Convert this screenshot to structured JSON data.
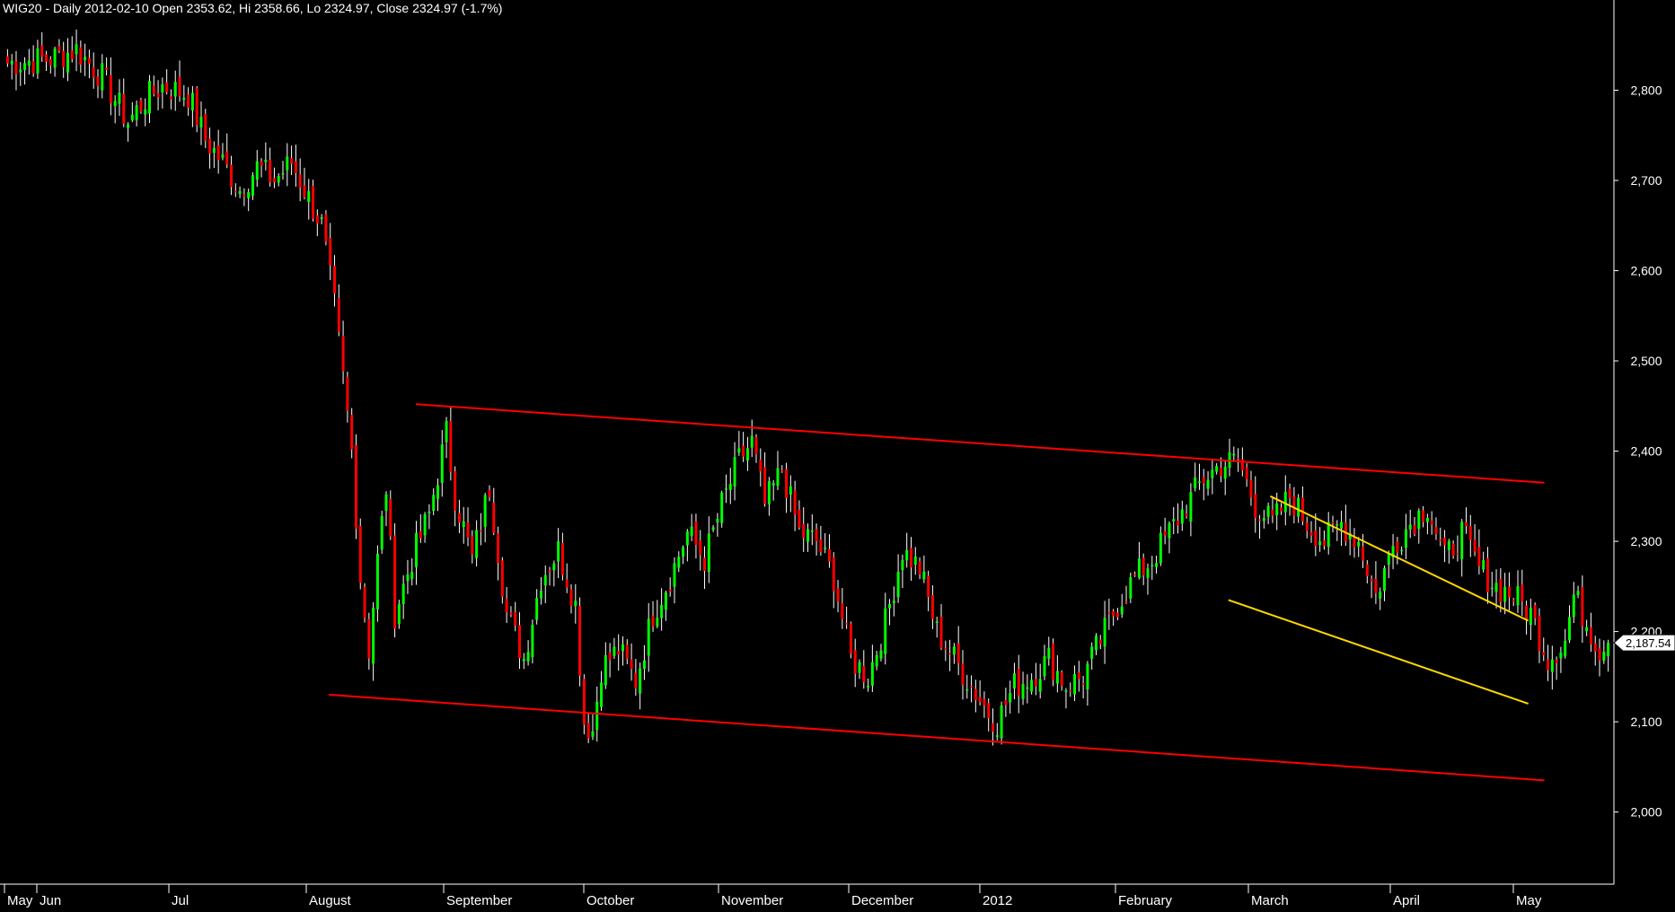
{
  "chart_title": "WIG20 - Daily 2012-02-10 Open 2353.62, Hi 2358.66, Lo 2324.97, Close 2324.97 (-1.7%)",
  "chart_data": {
    "type": "candlestick",
    "instrument": "WIG20",
    "ylim": [
      1920,
      2900
    ],
    "y_ticks": [
      2000,
      2100,
      2200,
      2300,
      2400,
      2500,
      2600,
      2700,
      2800
    ],
    "y_tick_labels": [
      "2,000",
      "2,100",
      "2,200",
      "2,300",
      "2,400",
      "2,500",
      "2,600",
      "2,700",
      "2,800"
    ],
    "x_labels": [
      "May",
      "Jun",
      "Jul",
      "August",
      "September",
      "October",
      "November",
      "December",
      "2012",
      "February",
      "March",
      "April",
      "May"
    ],
    "last_value_label": "2,187.54",
    "last_value": 2187.54,
    "series_colors": {
      "up": "#00ff00",
      "down": "#ff0000",
      "channel": "#ff0000",
      "wedge": "#ffd700"
    },
    "waypoints": [
      [
        0,
        2830
      ],
      [
        10,
        2835
      ],
      [
        16,
        2845
      ],
      [
        22,
        2815
      ],
      [
        28,
        2765
      ],
      [
        32,
        2790
      ],
      [
        36,
        2805
      ],
      [
        42,
        2795
      ],
      [
        46,
        2745
      ],
      [
        50,
        2720
      ],
      [
        54,
        2690
      ],
      [
        58,
        2715
      ],
      [
        62,
        2700
      ],
      [
        66,
        2720
      ],
      [
        70,
        2680
      ],
      [
        73,
        2650
      ],
      [
        76,
        2560
      ],
      [
        78,
        2480
      ],
      [
        80,
        2400
      ],
      [
        82,
        2260
      ],
      [
        84,
        2180
      ],
      [
        86,
        2280
      ],
      [
        88,
        2360
      ],
      [
        90,
        2220
      ],
      [
        94,
        2280
      ],
      [
        98,
        2330
      ],
      [
        102,
        2420
      ],
      [
        104,
        2350
      ],
      [
        108,
        2280
      ],
      [
        112,
        2360
      ],
      [
        116,
        2220
      ],
      [
        120,
        2170
      ],
      [
        124,
        2260
      ],
      [
        128,
        2290
      ],
      [
        132,
        2230
      ],
      [
        134,
        2100
      ],
      [
        136,
        2090
      ],
      [
        138,
        2160
      ],
      [
        142,
        2180
      ],
      [
        146,
        2145
      ],
      [
        150,
        2220
      ],
      [
        154,
        2260
      ],
      [
        158,
        2310
      ],
      [
        162,
        2280
      ],
      [
        166,
        2340
      ],
      [
        170,
        2390
      ],
      [
        173,
        2410
      ],
      [
        176,
        2340
      ],
      [
        180,
        2380
      ],
      [
        184,
        2310
      ],
      [
        188,
        2300
      ],
      [
        192,
        2260
      ],
      [
        196,
        2170
      ],
      [
        200,
        2150
      ],
      [
        204,
        2210
      ],
      [
        208,
        2290
      ],
      [
        212,
        2270
      ],
      [
        216,
        2200
      ],
      [
        220,
        2170
      ],
      [
        224,
        2140
      ],
      [
        228,
        2110
      ],
      [
        230,
        2100
      ],
      [
        234,
        2140
      ],
      [
        238,
        2150
      ],
      [
        242,
        2170
      ],
      [
        246,
        2140
      ],
      [
        250,
        2150
      ],
      [
        254,
        2190
      ],
      [
        258,
        2230
      ],
      [
        262,
        2260
      ],
      [
        266,
        2280
      ],
      [
        270,
        2310
      ],
      [
        274,
        2340
      ],
      [
        278,
        2370
      ],
      [
        282,
        2385
      ],
      [
        286,
        2390
      ],
      [
        290,
        2340
      ],
      [
        294,
        2320
      ],
      [
        298,
        2350
      ],
      [
        302,
        2320
      ],
      [
        306,
        2300
      ],
      [
        310,
        2320
      ],
      [
        314,
        2300
      ],
      [
        318,
        2240
      ],
      [
        322,
        2295
      ],
      [
        326,
        2320
      ],
      [
        330,
        2340
      ],
      [
        334,
        2280
      ],
      [
        338,
        2310
      ],
      [
        342,
        2270
      ],
      [
        346,
        2250
      ],
      [
        350,
        2240
      ],
      [
        354,
        2220
      ],
      [
        358,
        2170
      ],
      [
        362,
        2190
      ],
      [
        364,
        2240
      ],
      [
        367,
        2210
      ],
      [
        370,
        2180
      ],
      [
        372,
        2187
      ]
    ],
    "upper_channel_line": [
      [
        0.258,
        2452
      ],
      [
        0.958,
        2365
      ]
    ],
    "lower_channel_line": [
      [
        0.204,
        2130
      ],
      [
        0.958,
        2035
      ]
    ],
    "wedge_upper_line": [
      [
        0.788,
        2350
      ],
      [
        0.948,
        2212
      ]
    ],
    "wedge_lower_line": [
      [
        0.762,
        2235
      ],
      [
        0.948,
        2120
      ]
    ]
  }
}
